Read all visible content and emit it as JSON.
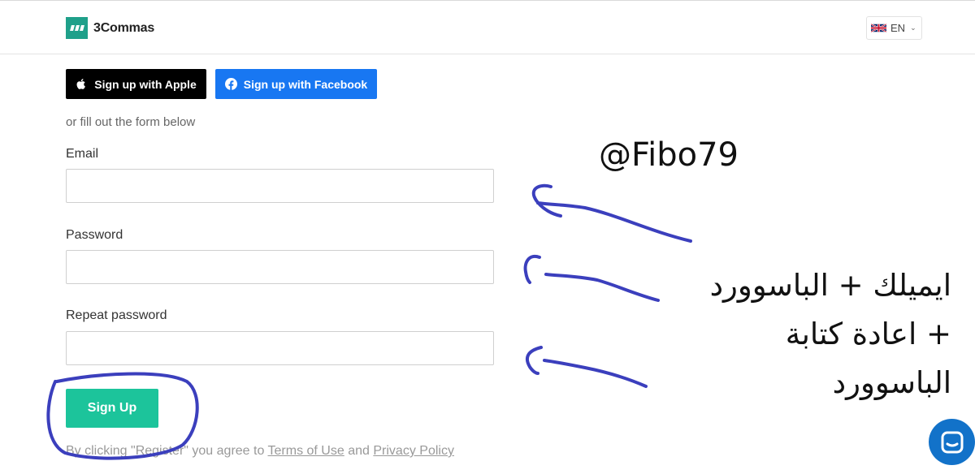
{
  "header": {
    "brand": "3Commas",
    "language": "EN"
  },
  "social": {
    "apple_label": "Sign up with Apple",
    "facebook_label": "Sign up with Facebook"
  },
  "form": {
    "intro": "or fill out the form below",
    "email_label": "Email",
    "email_value": "",
    "password_label": "Password",
    "password_value": "",
    "repeat_label": "Repeat password",
    "repeat_value": "",
    "submit_label": "Sign Up"
  },
  "legal": {
    "prefix": "By clicking \"Register\" you agree to",
    "terms_label": "Terms of Use",
    "and": "and",
    "privacy_label": "Privacy Policy"
  },
  "annotation": {
    "handle": "@Fibo79",
    "note_line1": "ايميلك + الباسوورد",
    "note_line2": "+ اعادة كتابة",
    "note_line3": "الباسوورد",
    "ink_color": "#3b3fbd"
  },
  "colors": {
    "brand": "#1fa08a",
    "signup": "#1cc49b",
    "facebook": "#1877f2",
    "chat": "#1272c9"
  },
  "icons": [
    "apple-icon",
    "facebook-icon",
    "uk-flag-icon",
    "chevron-down-icon",
    "chat-icon"
  ]
}
